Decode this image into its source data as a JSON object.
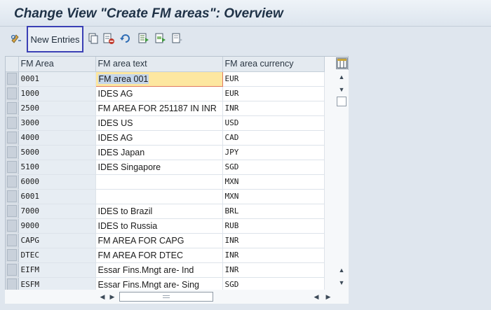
{
  "window": {
    "title": "Change View \"Create FM areas\": Overview"
  },
  "toolbar": {
    "new_entries_label": "New Entries",
    "icons": [
      "display-change-icon",
      "copy-icon",
      "delete-icon",
      "undo-icon",
      "select-all-icon",
      "select-block-icon",
      "deselect-all-icon"
    ]
  },
  "table": {
    "columns": [
      "FM Area",
      "FM area text",
      "FM area currency"
    ],
    "rows": [
      {
        "area": "0001",
        "text": "FM area 001",
        "currency": "EUR"
      },
      {
        "area": "1000",
        "text": "IDES AG",
        "currency": "EUR"
      },
      {
        "area": "2500",
        "text": "FM AREA FOR 251187 IN INR",
        "currency": "INR"
      },
      {
        "area": "3000",
        "text": "IDES US",
        "currency": "USD"
      },
      {
        "area": "4000",
        "text": "IDES AG",
        "currency": "CAD"
      },
      {
        "area": "5000",
        "text": "IDES Japan",
        "currency": "JPY"
      },
      {
        "area": "5100",
        "text": "IDES Singapore",
        "currency": "SGD"
      },
      {
        "area": "6000",
        "text": "",
        "currency": "MXN"
      },
      {
        "area": "6001",
        "text": "",
        "currency": "MXN"
      },
      {
        "area": "7000",
        "text": "IDES to Brazil",
        "currency": "BRL"
      },
      {
        "area": "9000",
        "text": "IDES to Russia",
        "currency": "RUB"
      },
      {
        "area": "CAPG",
        "text": "FM AREA FOR CAPG",
        "currency": "INR"
      },
      {
        "area": "DTEC",
        "text": "FM AREA FOR DTEC",
        "currency": "INR"
      },
      {
        "area": "EIFM",
        "text": "Essar Fins.Mngt are- Ind",
        "currency": "INR"
      },
      {
        "area": "ESFM",
        "text": "Essar Fins.Mngt are- Sing",
        "currency": "SGD"
      }
    ]
  },
  "colors": {
    "focus_cell": "#fde7a0",
    "highlight_border": "#3a3fb5"
  }
}
